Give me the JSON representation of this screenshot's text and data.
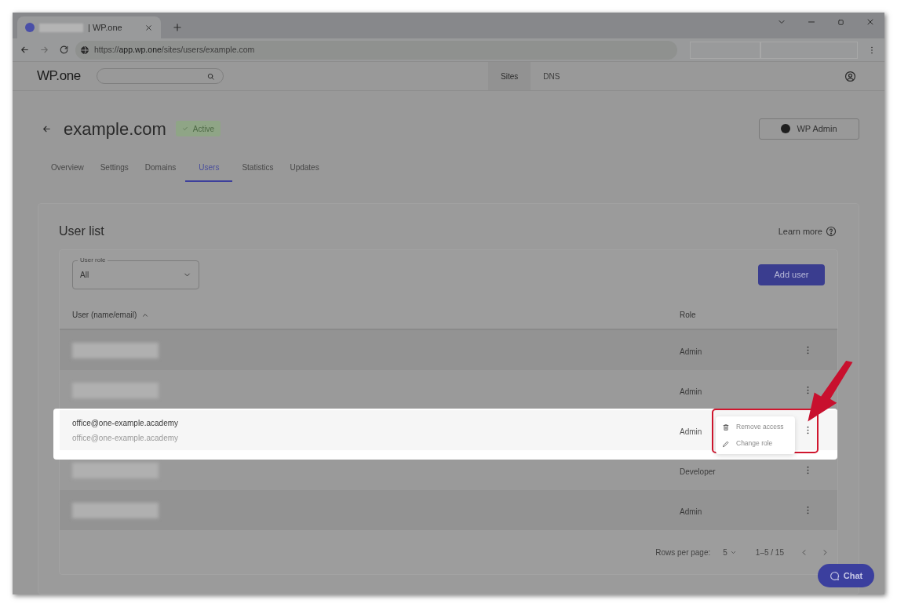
{
  "browser": {
    "tab": {
      "title": "| WP.one",
      "redacted": true
    },
    "url": {
      "scheme": "https://",
      "host": "app.wp.one",
      "path": "/sites/users/example.com"
    }
  },
  "header": {
    "logo": "WP.one",
    "nav": [
      {
        "label": "Sites",
        "selected": true
      },
      {
        "label": "DNS",
        "selected": false
      }
    ]
  },
  "site": {
    "title": "example.com",
    "status": "Active",
    "admin_button": "WP Admin"
  },
  "tabs": [
    {
      "label": "Overview",
      "selected": false
    },
    {
      "label": "Settings",
      "selected": false
    },
    {
      "label": "Domains",
      "selected": false
    },
    {
      "label": "Users",
      "selected": true
    },
    {
      "label": "Statistics",
      "selected": false
    },
    {
      "label": "Updates",
      "selected": false
    }
  ],
  "user_list": {
    "title": "User list",
    "learn_more": "Learn more",
    "filter": {
      "label": "User role",
      "value": "All"
    },
    "add_button": "Add user",
    "columns": [
      {
        "label": "User (name/email)",
        "sorted_ascending": true
      },
      {
        "label": "Role"
      }
    ],
    "rows": [
      {
        "kind": "redacted",
        "role": "Admin",
        "highlighted": false
      },
      {
        "kind": "redacted",
        "role": "Admin",
        "highlighted": false
      },
      {
        "kind": "visible",
        "name": "office@one-example.academy",
        "email": "office@one-example.academy",
        "role": "Admin",
        "highlighted": true,
        "menu": [
          {
            "kind": "delete",
            "label": "Remove access"
          },
          {
            "kind": "edit",
            "label": "Change role"
          }
        ]
      },
      {
        "kind": "redacted",
        "role": "Developer",
        "highlighted": false
      },
      {
        "kind": "redacted",
        "role": "Admin",
        "highlighted": false
      }
    ],
    "footer": {
      "rows_label": "Rows per page:",
      "rows_value": "5",
      "range": "1–5 / 15"
    }
  },
  "chat_button": "Chat"
}
